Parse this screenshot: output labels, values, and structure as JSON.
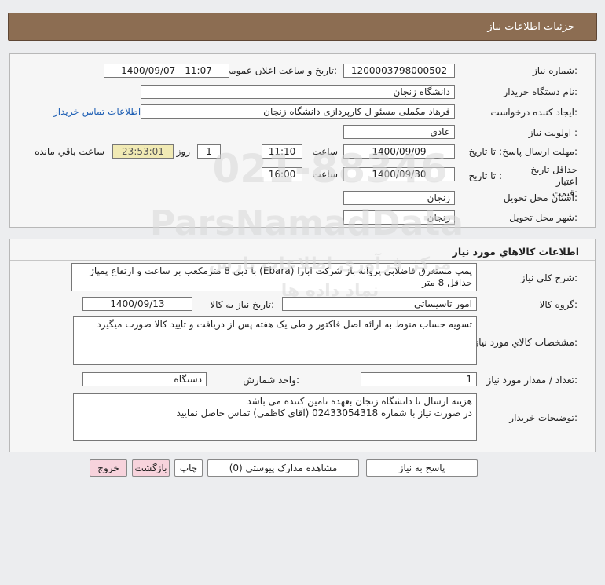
{
  "page": {
    "title": "جزئيات اطلاعات نياز"
  },
  "need_info": {
    "need_number_label": "شماره نياز:",
    "need_number": "1200003798000502",
    "announce_label": "تاريخ و ساعت اعلان عمومی:",
    "announce_value": "1400/09/07 - 11:07",
    "buyer_org_label": "نام دستگاه خريدار:",
    "buyer_org": "دانشگاه زنجان",
    "requester_label": "ايجاد کننده درخواست:",
    "requester": "فرهاد مکملی مسئو ل کارپردازی دانشگاه زنجان",
    "contact_link": "اطلاعات تماس خريدار",
    "priority_label": "اولويت نياز :",
    "priority": "عادي",
    "reply_deadline_label": "مهلت ارسال پاسخ:",
    "until_date_label": "تا تاريخ :",
    "reply_date": "1400/09/09",
    "time_label": "ساعت",
    "reply_time": "11:10",
    "days_value": "1",
    "days_label": "روز و",
    "remaining_time": "23:53:01",
    "remaining_label": "ساعت باقي مانده",
    "validity_label": "حداقل تاريخ اعتبار قيمت:",
    "validity_until_label": "تا تاريخ :",
    "validity_date": "1400/09/30",
    "validity_time_label": "ساعت",
    "validity_time": "16:00",
    "province_label": "استان محل تحويل:",
    "province": "زنجان",
    "city_label": "شهر محل تحويل:",
    "city": "زنجان"
  },
  "goods": {
    "section_title": "اطلاعات کالاهاي مورد نياز",
    "general_desc_label": "شرح کلي نياز:",
    "general_desc": "پمپ مستغرق فاضلابی پروانه باز شرکت ابارا (Ebara) با دبی 8 مترمکعب بر ساعت و ارتفاع پمپاژ حداقل 8 متر",
    "group_label": "گروه کالا:",
    "group": "امور تاسيساتي",
    "need_date_label": "تاريخ نياز به کالا:",
    "need_date": "1400/09/13",
    "specs_label": "مشخصات کالاي مورد نياز:",
    "specs": "تسويه حساب منوط به ارائه اصل فاکتور و طی يک هفته پس از دريافت و تاييد کالا صورت ميگيرد",
    "qty_label": "تعداد / مقدار مورد نياز:",
    "qty": "1",
    "unit_label": "واحد شمارش:",
    "unit": "دستگاه",
    "buyer_notes_label": "توضيحات خريدار:",
    "buyer_notes_1": "هزينه ارسال تا دانشگاه زنجان بعهده تامين کننده می باشد",
    "buyer_notes_2": "در صورت نياز با شماره 02433054318 (آقای کاظمی) تماس حاصل نماييد"
  },
  "buttons": {
    "reply": "پاسخ به نياز",
    "attachments": "مشاهده مدارک پيوستي (0)",
    "print": "چاپ",
    "back": "بازگشت",
    "exit": "خروج"
  },
  "watermark": {
    "line1": "021-88346",
    "line2": "ParsNamadData",
    "line3": "مرکز فرآوری اطلاعات پارس نماد داده ها"
  }
}
